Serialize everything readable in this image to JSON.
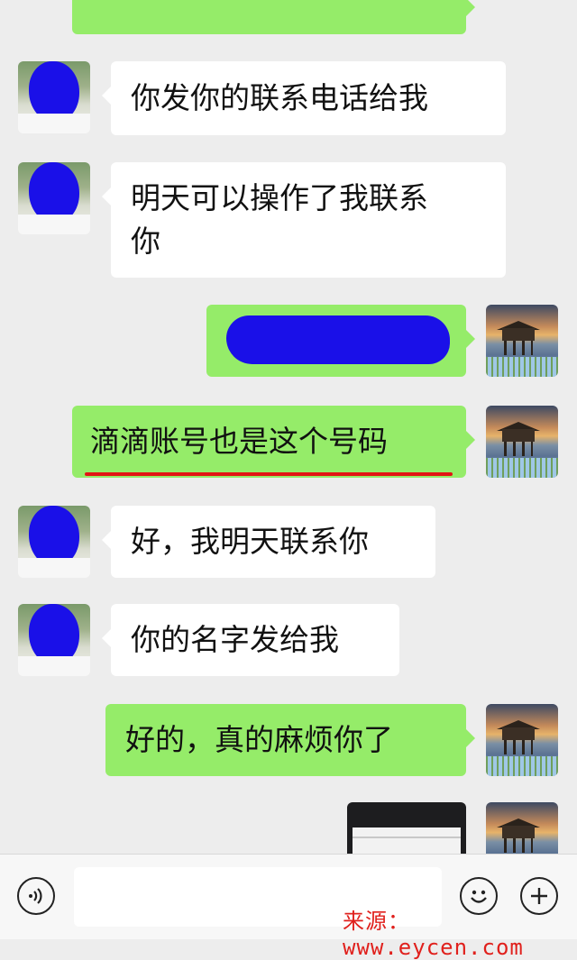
{
  "messages": [
    {
      "side": "left",
      "text": "你发你的联系电话给我"
    },
    {
      "side": "left",
      "line1": "明天可以操作了我联系",
      "line2": "你"
    },
    {
      "side": "right",
      "redacted": true
    },
    {
      "side": "right",
      "text": "滴滴账号也是这个号码",
      "underlined": true
    },
    {
      "side": "left",
      "text": "好，我明天联系你"
    },
    {
      "side": "left",
      "text": "你的名字发给我"
    },
    {
      "side": "right",
      "text": "好的，真的麻烦你了"
    },
    {
      "side": "right",
      "image": true
    }
  ],
  "toolbar": {
    "voice_icon": "voice-icon",
    "emoji_icon": "emoji-icon",
    "plus_icon": "plus-icon"
  },
  "watermark": "来源：www.eycen.com",
  "colors": {
    "background": "#ededed",
    "bubble_self": "#95ec69",
    "bubble_other": "#ffffff",
    "redaction": "#1a10e8",
    "underline": "#e21414",
    "watermark": "#e0201c"
  }
}
